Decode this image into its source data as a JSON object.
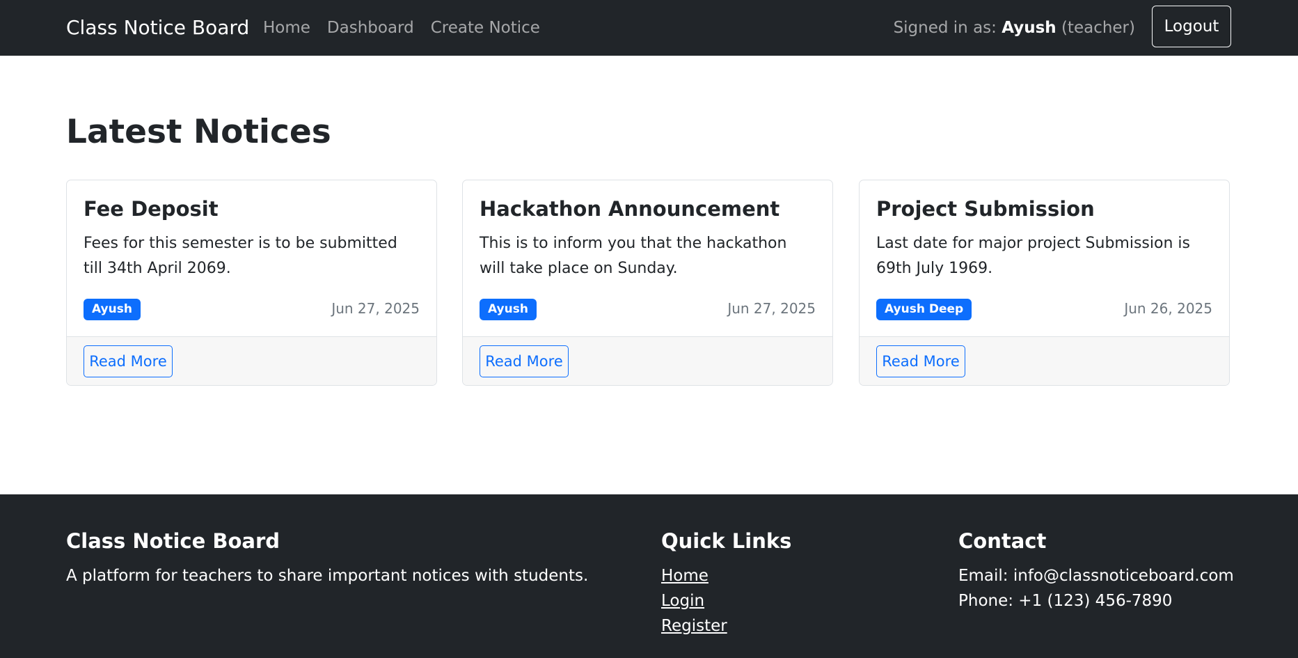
{
  "navbar": {
    "brand": "Class Notice Board",
    "links": [
      "Home",
      "Dashboard",
      "Create Notice"
    ],
    "signed_in_prefix": "Signed in as:",
    "user_name": "Ayush",
    "user_role": "(teacher)",
    "logout_label": "Logout"
  },
  "main": {
    "title": "Latest Notices",
    "notices": [
      {
        "title": "Fee Deposit",
        "text": "Fees for this semester is to be submitted till 34th April 2069.",
        "author": "Ayush",
        "date": "Jun 27, 2025",
        "button": "Read More"
      },
      {
        "title": "Hackathon Announcement",
        "text": "This is to inform you that the hackathon will take place on Sunday.",
        "author": "Ayush",
        "date": "Jun 27, 2025",
        "button": "Read More"
      },
      {
        "title": "Project Submission",
        "text": "Last date for major project Submission is 69th July 1969.",
        "author": "Ayush Deep",
        "date": "Jun 26, 2025",
        "button": "Read More"
      }
    ]
  },
  "footer": {
    "about_title": "Class Notice Board",
    "about_text": "A platform for teachers to share important notices with students.",
    "links_title": "Quick Links",
    "links": [
      "Home",
      "Login",
      "Register"
    ],
    "contact_title": "Contact",
    "email": "Email: info@classnoticeboard.com",
    "phone": "Phone: +1 (123) 456-7890"
  },
  "colors": {
    "navbar_bg": "#212529",
    "primary": "#0d6efd",
    "card_footer_bg": "#f7f7f7",
    "muted_text": "#6c757d"
  }
}
